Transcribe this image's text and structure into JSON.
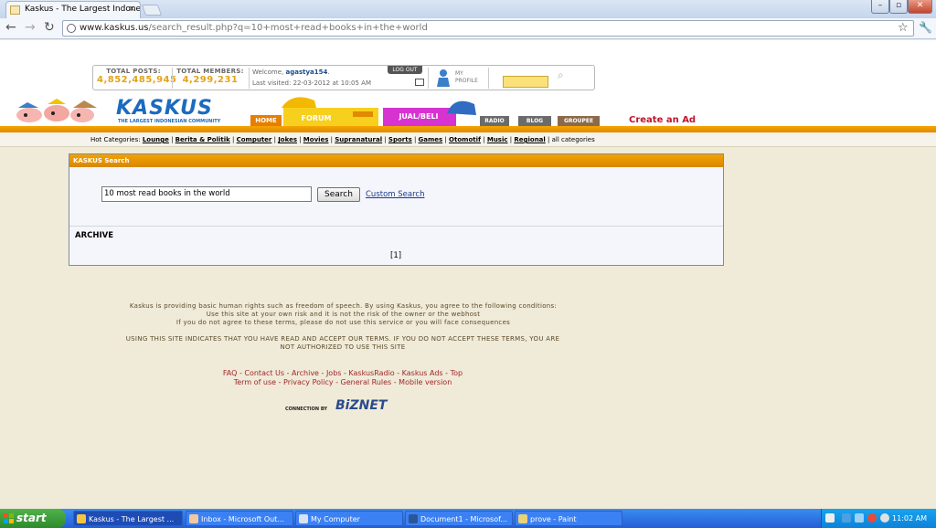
{
  "browser": {
    "tab_title": "Kaskus - The Largest Indonesi",
    "tab_close": "×",
    "url_domain": "www.kaskus.us",
    "url_path": "/search_result.php?q=10+most+read+books+in+the+world"
  },
  "header": {
    "total_posts_label": "TOTAL POSTS:",
    "total_posts": "4,852,485,945",
    "total_members_label": "TOTAL MEMBERS:",
    "total_members": "4,299,231",
    "welcome_prefix": "Welcome,",
    "username": "agastya154",
    "last_visited_label": "Last visited:",
    "last_visited": "22-03-2012",
    "at_label": "at",
    "last_visited_time": "10:05 AM",
    "logout": "LOG OUT",
    "profile_label_1": "MY",
    "profile_label_2": "PROFILE",
    "logo_text": "KASKUS",
    "logo_sub": "THE LARGEST INDONESIAN COMMUNITY",
    "nav": {
      "home": "HOME",
      "forum": "FORUM",
      "jualbeli": "JUAL/BELI",
      "radio": "RADIO",
      "blog": "BLOG",
      "groupee": "GROUPEE"
    },
    "create_ad": "Create an Ad"
  },
  "hot_categories": {
    "label": "Hot Categories:",
    "items": [
      "Lounge",
      "Berita & Politik",
      "Computer",
      "Jokes",
      "Movies",
      "Supranatural",
      "Sports",
      "Games",
      "Otomotif",
      "Music",
      "Regional"
    ],
    "all": "all categories"
  },
  "search": {
    "panel_title": "KASKUS Search",
    "query": "10 most read books in the world",
    "button": "Search",
    "custom": "Custom Search",
    "archive": "ARCHIVE",
    "page": "[1]"
  },
  "footer": {
    "terms_1": "Kaskus is providing basic human rights such as freedom of speech. By using Kaskus, you agree to the following conditions:",
    "terms_2": "Use this site at your own risk and it is not the risk of the owner or the webhost",
    "terms_3": "If you do not agree to these terms, please do not use this service or you will face consequences",
    "terms_4": "USING THIS SITE INDICATES THAT YOU HAVE READ AND ACCEPT OUR TERMS. IF YOU DO NOT ACCEPT THESE TERMS, YOU ARE",
    "terms_5": "NOT AUTHORIZED TO USE THIS SITE",
    "links_1": "FAQ - Contact Us - Archive - Jobs - KaskusRadio - Kaskus Ads - Top",
    "links_2": "Term of use - Privacy Policy - General Rules - Mobile version",
    "connection_by": "CONNECTION BY",
    "biznet": "BiZNET"
  },
  "taskbar": {
    "start": "start",
    "tasks": [
      "Kaskus - The Largest ...",
      "Inbox - Microsoft Out...",
      "My Computer",
      "Document1 - Microsof...",
      "prove - Paint"
    ],
    "clock": "11:02 AM"
  },
  "colors": {
    "kaskus_orange": "#f5a300",
    "kaskus_blue": "#1c6bbf",
    "link_red": "#a0282a"
  }
}
